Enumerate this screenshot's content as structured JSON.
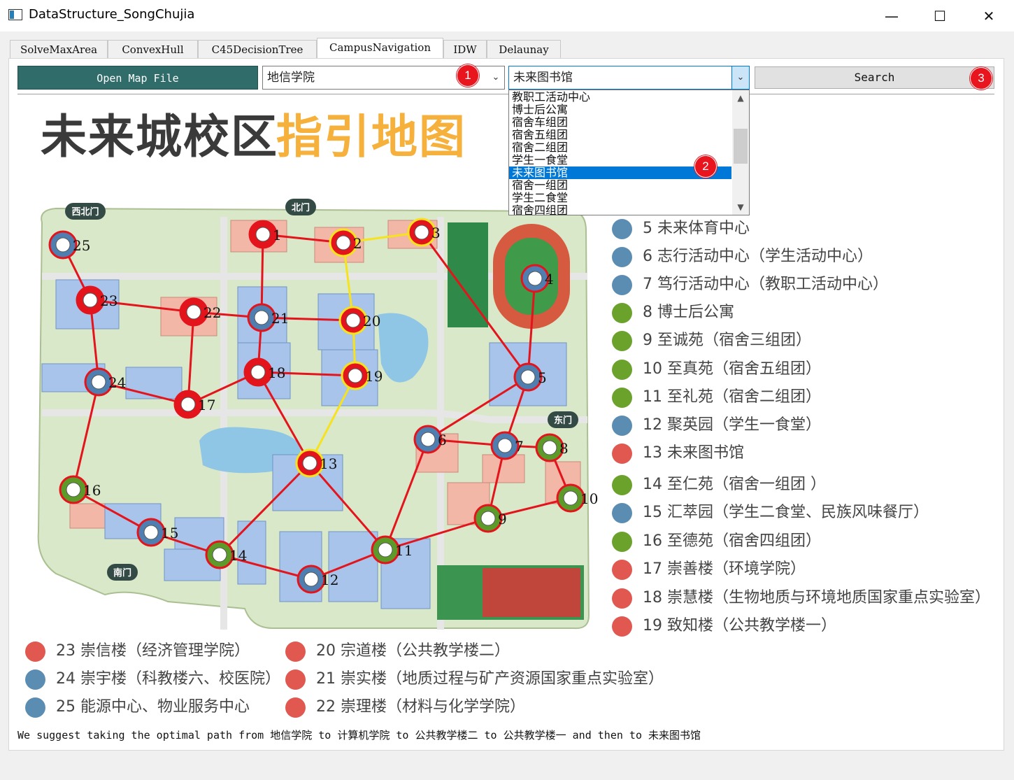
{
  "window": {
    "title": "DataStructure_SongChujia",
    "controls": [
      "minimize",
      "maximize",
      "close"
    ]
  },
  "tabs": [
    {
      "label": "SolveMaxArea",
      "active": false
    },
    {
      "label": "ConvexHull",
      "active": false
    },
    {
      "label": "C45DecisionTree",
      "active": false
    },
    {
      "label": "CampusNavigation",
      "active": true
    },
    {
      "label": "IDW",
      "active": false
    },
    {
      "label": "Delaunay",
      "active": false
    }
  ],
  "toolbar": {
    "open_label": "Open Map File",
    "start_value": "地信学院",
    "end_value": "未来图书馆",
    "search_label": "Search",
    "badges": [
      "1",
      "2",
      "3"
    ]
  },
  "dropdown": {
    "items": [
      "教职工活动中心",
      "博士后公寓",
      "宿舍车组团",
      "宿舍五组团",
      "宿舍二组团",
      "学生一食堂",
      "未来图书馆",
      "宿舍一组团",
      "学生二食堂",
      "宿舍四组团"
    ],
    "selected": "未来图书馆"
  },
  "map": {
    "title_dark": "未来城校区",
    "title_accent": "指引地图",
    "gates": [
      "西北门",
      "北门",
      "东门",
      "南门"
    ],
    "nodes": [
      {
        "id": "1",
        "ring": "red",
        "dot": "red"
      },
      {
        "id": "2",
        "ring": "yellow",
        "dot": "red"
      },
      {
        "id": "3",
        "ring": "yellow",
        "dot": "red"
      },
      {
        "id": "4",
        "ring": "red",
        "dot": "blue"
      },
      {
        "id": "5",
        "ring": "red",
        "dot": "blue"
      },
      {
        "id": "6",
        "ring": "red",
        "dot": "blue"
      },
      {
        "id": "7",
        "ring": "red",
        "dot": "blue"
      },
      {
        "id": "8",
        "ring": "red",
        "dot": "green"
      },
      {
        "id": "9",
        "ring": "red",
        "dot": "green"
      },
      {
        "id": "10",
        "ring": "red",
        "dot": "green"
      },
      {
        "id": "11",
        "ring": "red",
        "dot": "green"
      },
      {
        "id": "12",
        "ring": "red",
        "dot": "blue"
      },
      {
        "id": "13",
        "ring": "yellow",
        "dot": "red"
      },
      {
        "id": "14",
        "ring": "red",
        "dot": "green"
      },
      {
        "id": "15",
        "ring": "red",
        "dot": "blue"
      },
      {
        "id": "16",
        "ring": "red",
        "dot": "green"
      },
      {
        "id": "17",
        "ring": "red",
        "dot": "red"
      },
      {
        "id": "18",
        "ring": "red",
        "dot": "red"
      },
      {
        "id": "19",
        "ring": "yellow",
        "dot": "red"
      },
      {
        "id": "20",
        "ring": "yellow",
        "dot": "red"
      },
      {
        "id": "21",
        "ring": "red",
        "dot": "blue"
      },
      {
        "id": "22",
        "ring": "red",
        "dot": "red"
      },
      {
        "id": "23",
        "ring": "red",
        "dot": "red"
      },
      {
        "id": "24",
        "ring": "red",
        "dot": "blue"
      },
      {
        "id": "25",
        "ring": "red",
        "dot": "blue"
      }
    ],
    "edges": [
      [
        "1",
        "2"
      ],
      [
        "1",
        "21"
      ],
      [
        "3",
        "5"
      ],
      [
        "4",
        "5"
      ],
      [
        "5",
        "6"
      ],
      [
        "5",
        "7"
      ],
      [
        "6",
        "7"
      ],
      [
        "7",
        "8"
      ],
      [
        "7",
        "9"
      ],
      [
        "8",
        "10"
      ],
      [
        "9",
        "10"
      ],
      [
        "9",
        "11"
      ],
      [
        "11",
        "12"
      ],
      [
        "11",
        "13"
      ],
      [
        "12",
        "14"
      ],
      [
        "13",
        "14"
      ],
      [
        "13",
        "18"
      ],
      [
        "14",
        "15"
      ],
      [
        "15",
        "16"
      ],
      [
        "16",
        "24"
      ],
      [
        "17",
        "22"
      ],
      [
        "17",
        "24"
      ],
      [
        "18",
        "17"
      ],
      [
        "18",
        "19"
      ],
      [
        "18",
        "21"
      ],
      [
        "21",
        "20"
      ],
      [
        "21",
        "22"
      ],
      [
        "22",
        "23"
      ],
      [
        "23",
        "24"
      ],
      [
        "23",
        "25"
      ],
      [
        "6",
        "11"
      ]
    ],
    "path_edges": [
      [
        "2",
        "3"
      ],
      [
        "2",
        "20"
      ],
      [
        "20",
        "19"
      ],
      [
        "19",
        "13"
      ]
    ]
  },
  "legend_right": [
    {
      "text": "5 未来体育中心",
      "color": "#5b8db3"
    },
    {
      "text": "6 志行活动中心（学生活动中心）",
      "color": "#5b8db3"
    },
    {
      "text": "7 笃行活动中心（教职工活动中心）",
      "color": "#5b8db3"
    },
    {
      "text": "8 博士后公寓",
      "color": "#6aa22c"
    },
    {
      "text": "9 至诚苑（宿舍三组团）",
      "color": "#6aa22c"
    },
    {
      "text": "10 至真苑（宿舍五组团）",
      "color": "#6aa22c"
    },
    {
      "text": "11 至礼苑（宿舍二组团）",
      "color": "#6aa22c"
    },
    {
      "text": "12 聚英园（学生一食堂）",
      "color": "#5b8db3"
    },
    {
      "text": "13 未来图书馆",
      "color": "#e0584f"
    },
    {
      "text": "14 至仁苑（宿舍一组团 ）",
      "color": "#6aa22c"
    },
    {
      "text": "15 汇萃园（学生二食堂、民族风味餐厅）",
      "color": "#5b8db3"
    },
    {
      "text": "16 至德苑（宿舍四组团）",
      "color": "#6aa22c"
    },
    {
      "text": "17 崇善楼（环境学院）",
      "color": "#e0584f"
    },
    {
      "text": "18 崇慧楼（生物地质与环境地质国家重点实验室）",
      "color": "#e0584f"
    },
    {
      "text": "19 致知楼（公共教学楼一）",
      "color": "#e0584f"
    }
  ],
  "legend_bottom_left": [
    {
      "text": "23 崇信楼（经济管理学院）",
      "color": "#e0584f"
    },
    {
      "text": "24 崇宇楼（科教楼六、校医院）",
      "color": "#5b8db3"
    },
    {
      "text": "25 能源中心、物业服务中心",
      "color": "#5b8db3"
    }
  ],
  "legend_bottom_mid": [
    {
      "text": "20 宗道楼（公共教学楼二）",
      "color": "#e0584f"
    },
    {
      "text": "21 崇实楼（地质过程与矿产资源国家重点实验室）",
      "color": "#e0584f"
    },
    {
      "text": "22 崇理楼（材料与化学学院）",
      "color": "#e0584f"
    }
  ],
  "status_text": "We suggest taking the optimal path from 地信学院 to 计算机学院 to 公共教学楼二 to 公共教学楼一 and then to 未来图书馆"
}
